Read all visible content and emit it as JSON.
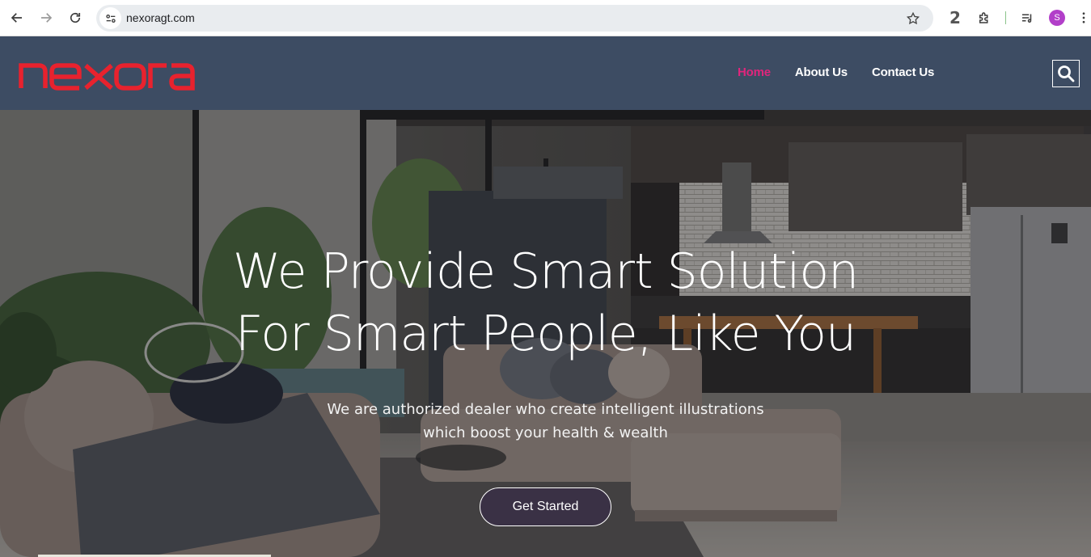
{
  "browser": {
    "url": "nexoragt.com",
    "extension_badge": "2",
    "profile_initial": "S",
    "icons": [
      "back-icon",
      "forward-icon",
      "reload-icon",
      "site-info-icon",
      "star-icon",
      "extensions-icon",
      "media-control-icon",
      "menu-dots-icon"
    ]
  },
  "header": {
    "logo_text": "nexora",
    "logo_color": "#e8222e",
    "background": "#3d4c63",
    "nav": [
      {
        "label": "Home",
        "active": true
      },
      {
        "label": "About Us",
        "active": false
      },
      {
        "label": "Contact Us",
        "active": false
      }
    ],
    "active_color": "#e0257c",
    "search_icon": "search-icon"
  },
  "hero": {
    "title_line1": "We Provide Smart Solution",
    "title_line2": "For Smart People, Like You",
    "subtitle_line1": "We are authorized dealer who create intelligent illustrations",
    "subtitle_line2": "which boost your health & wealth",
    "cta_label": "Get Started"
  }
}
